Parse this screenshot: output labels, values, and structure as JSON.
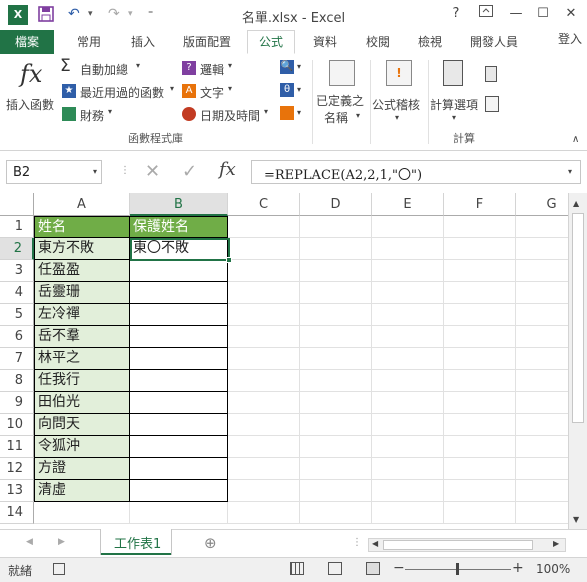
{
  "window": {
    "title": "名單.xlsx - Excel",
    "help": "?",
    "restore": "▢",
    "minimize": "—",
    "maximize": "☐",
    "close": "✕"
  },
  "quick_access": {
    "excel_icon": "excel-logo",
    "save": "save-icon",
    "undo": "undo-icon",
    "redo": "redo-icon"
  },
  "tabs": {
    "file": "檔案",
    "items": [
      "常用",
      "插入",
      "版面配置",
      "公式",
      "資料",
      "校閱",
      "檢視",
      "開發人員"
    ],
    "active": "公式",
    "signin": "登入"
  },
  "ribbon": {
    "insert_function": "插入函數",
    "autosum": "自動加總",
    "recent": "最近用過的函數",
    "financial": "財務",
    "logical": "邏輯",
    "text": "文字",
    "datetime": "日期及時間",
    "defined_names": [
      "已定義之",
      "名稱"
    ],
    "formula_auditing": "公式稽核",
    "calc_options": "計算選項",
    "group_library": "函數程式庫",
    "group_calc": "計算",
    "fx": "fx",
    "sigma": "Σ",
    "accent": "#217346",
    "logical_color": "#7f3fa0",
    "text_color": "#e8730b",
    "datetime_color": "#c23b22",
    "financial_color": "#2e8b57",
    "recent_color": "#2f5ea8"
  },
  "formula_bar": {
    "namebox": "B2",
    "formula": "=REPLACE(A2,2,1,\"〇\")",
    "fx": "fx"
  },
  "grid": {
    "columns": [
      "A",
      "B",
      "C",
      "D",
      "E",
      "F",
      "G"
    ],
    "rows": [
      "1",
      "2",
      "3",
      "4",
      "5",
      "6",
      "7",
      "8",
      "9",
      "10",
      "11",
      "12",
      "13",
      "14"
    ],
    "a_values": [
      "姓名",
      "東方不敗",
      "任盈盈",
      "岳靈珊",
      "左冷禪",
      "岳不羣",
      "林平之",
      "任我行",
      "田伯光",
      "向問天",
      "令狐沖",
      "方證",
      "清虛"
    ],
    "b_values": [
      "保護姓名",
      "東〇不敗",
      "",
      "",
      "",
      "",
      "",
      "",
      "",
      "",
      "",
      "",
      ""
    ],
    "header_fill": "#70ad47",
    "a_fill": "#e2efda"
  },
  "sheetbar": {
    "sheet": "工作表1",
    "add": "⊕"
  },
  "status": {
    "ready": "就緒",
    "zoom": "100%",
    "minus": "−",
    "plus": "+"
  }
}
